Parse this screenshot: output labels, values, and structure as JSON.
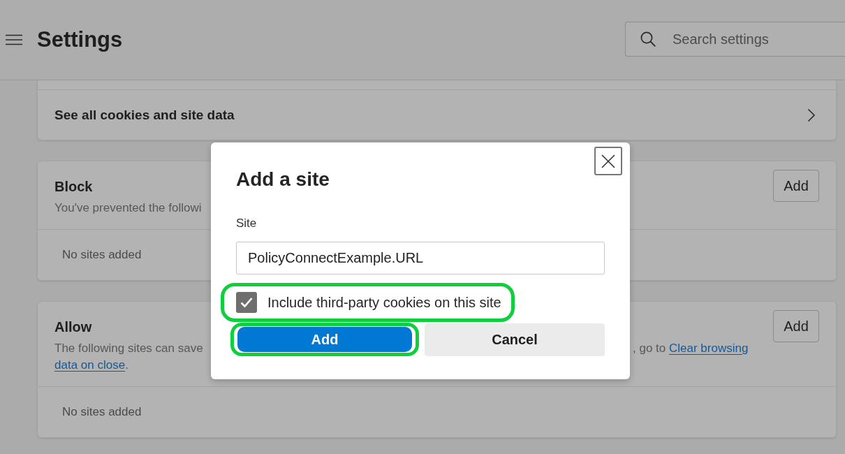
{
  "header": {
    "title": "Settings",
    "search": {
      "placeholder": "Search settings"
    }
  },
  "cards": [
    {
      "kind": "link_row",
      "label": "See all cookies and site data"
    },
    {
      "kind": "site_list",
      "title": "Block",
      "button": "Add",
      "description_lines": [
        {
          "left": [
            {
              "kind": "text",
              "text": "You've prevented the followi"
            }
          ]
        }
      ],
      "empty_text": "No sites added"
    },
    {
      "kind": "site_list",
      "title": "Allow",
      "button": "Add",
      "description_lines": [
        {
          "left": [
            {
              "kind": "text",
              "text": "The following sites can save"
            }
          ],
          "right": [
            {
              "kind": "text",
              "text": ", go to"
            },
            {
              "kind": "link",
              "text": "Clear browsing"
            }
          ]
        },
        {
          "left": [
            {
              "kind": "link",
              "text": "data on close"
            },
            {
              "kind": "text",
              "text": "."
            }
          ]
        }
      ],
      "empty_text": "No sites added"
    }
  ],
  "dialog": {
    "title": "Add a site",
    "field_label": "Site",
    "field_value": "PolicyConnectExample.URL",
    "checkbox": {
      "label": "Include third-party cookies on this site",
      "checked": true,
      "highlighted": true
    },
    "buttons": [
      {
        "kind": "primary",
        "label": "Add",
        "highlighted": true
      },
      {
        "kind": "secondary",
        "label": "Cancel",
        "highlighted": false
      }
    ]
  }
}
